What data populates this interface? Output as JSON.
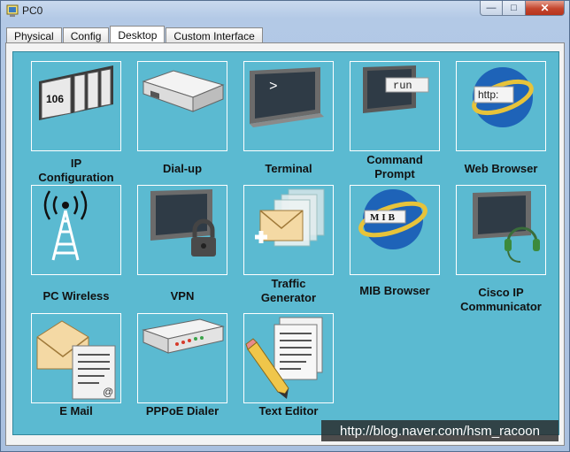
{
  "window": {
    "title": "PC0"
  },
  "window_controls": {
    "minimize": "—",
    "maximize": "□",
    "close": "✕"
  },
  "tabs": [
    {
      "label": "Physical",
      "active": false
    },
    {
      "label": "Config",
      "active": false
    },
    {
      "label": "Desktop",
      "active": true
    },
    {
      "label": "Custom Interface",
      "active": false
    }
  ],
  "desktop": {
    "background_color": "#5bbad1",
    "apps": [
      {
        "label_lines": [
          "IP",
          "Configuration"
        ],
        "icon": "ip-configuration-icon",
        "icon_text": "106"
      },
      {
        "label_lines": [
          "Dial-up"
        ],
        "icon": "modem-icon"
      },
      {
        "label_lines": [
          "Terminal"
        ],
        "icon": "terminal-icon",
        "icon_text": ">"
      },
      {
        "label_lines": [
          "Command",
          "Prompt"
        ],
        "icon": "command-prompt-icon",
        "icon_text": "run"
      },
      {
        "label_lines": [
          "Web Browser"
        ],
        "icon": "web-browser-icon",
        "icon_text": "http:"
      },
      {
        "label_lines": [
          "PC Wireless"
        ],
        "icon": "wireless-tower-icon"
      },
      {
        "label_lines": [
          "VPN"
        ],
        "icon": "vpn-lock-icon"
      },
      {
        "label_lines": [
          "Traffic",
          "Generator"
        ],
        "icon": "traffic-generator-icon"
      },
      {
        "label_lines": [
          "MIB Browser"
        ],
        "icon": "mib-browser-icon",
        "icon_text": "MIB"
      },
      {
        "label_lines": [
          "Cisco IP",
          "Communicator"
        ],
        "icon": "ip-communicator-icon"
      },
      {
        "label_lines": [
          "E Mail"
        ],
        "icon": "email-icon"
      },
      {
        "label_lines": [
          "PPPoE Dialer"
        ],
        "icon": "pppoe-dialer-icon"
      },
      {
        "label_lines": [
          "Text Editor"
        ],
        "icon": "text-editor-icon"
      }
    ]
  },
  "watermark": "http://blog.naver.com/hsm_racoon"
}
